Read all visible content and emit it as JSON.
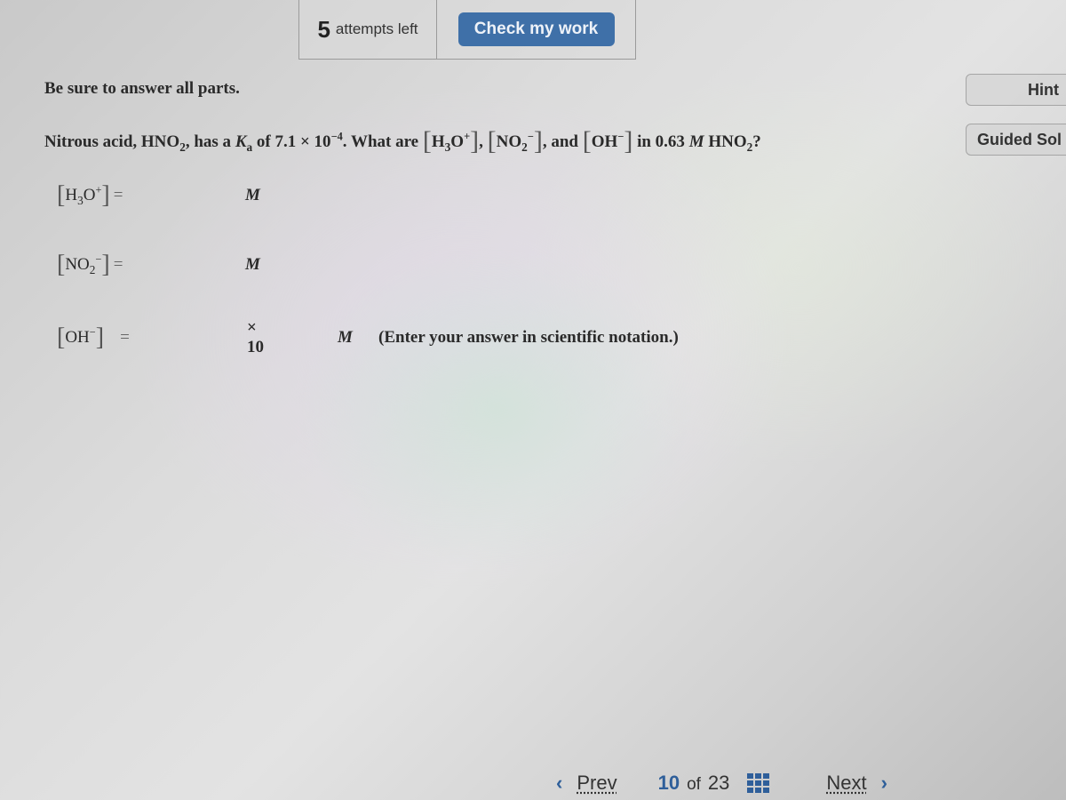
{
  "header": {
    "attempts_count": "5",
    "attempts_label": "attempts left",
    "check_button": "Check my work"
  },
  "side_buttons": {
    "hint": "Hint",
    "guided_solution": "Guided Sol"
  },
  "instructions": "Be sure to answer all parts.",
  "question": {
    "part1": "Nitrous acid, HNO",
    "sub2": "2",
    "part2": ", has a ",
    "ka_k": "K",
    "ka_sub": "a",
    "part3": " of 7.1 × 10",
    "exp": "−4",
    "part4": ". What are ",
    "h3o_h": "H",
    "h3o_sub": "3",
    "h3o_o": "O",
    "h3o_sup": "+",
    "comma": ", ",
    "no2_no": "NO",
    "no2_sub": "2",
    "no2_sup": "−",
    "and": ", and ",
    "oh": "OH",
    "oh_sup": "−",
    "part5": " in 0.63 ",
    "molar": "M",
    "part6": " HNO",
    "part6_sub": "2",
    "qmark": "?"
  },
  "answers": [
    {
      "label_main": "H",
      "label_sub": "3",
      "label_main2": "O",
      "label_sup": "+",
      "value": "",
      "unit": "M"
    },
    {
      "label_main": "NO",
      "label_sub": "2",
      "label_main2": "",
      "label_sup": "−",
      "value": "",
      "unit": "M"
    },
    {
      "label_main": "OH",
      "label_sub": "",
      "label_main2": "",
      "label_sup": "−",
      "value": "",
      "exponent": "",
      "times_ten": "× 10",
      "unit": "M",
      "note": "(Enter your answer in scientific notation.)"
    }
  ],
  "equals": "=",
  "brackets": {
    "open": "[",
    "close": "]"
  },
  "pager": {
    "prev": "Prev",
    "current": "10",
    "of": "of",
    "total": "23",
    "next": "Next",
    "prev_icon": "‹",
    "next_icon": "›"
  },
  "colors": {
    "accent": "#3f70a8",
    "link_blue": "#2f5f9a"
  }
}
